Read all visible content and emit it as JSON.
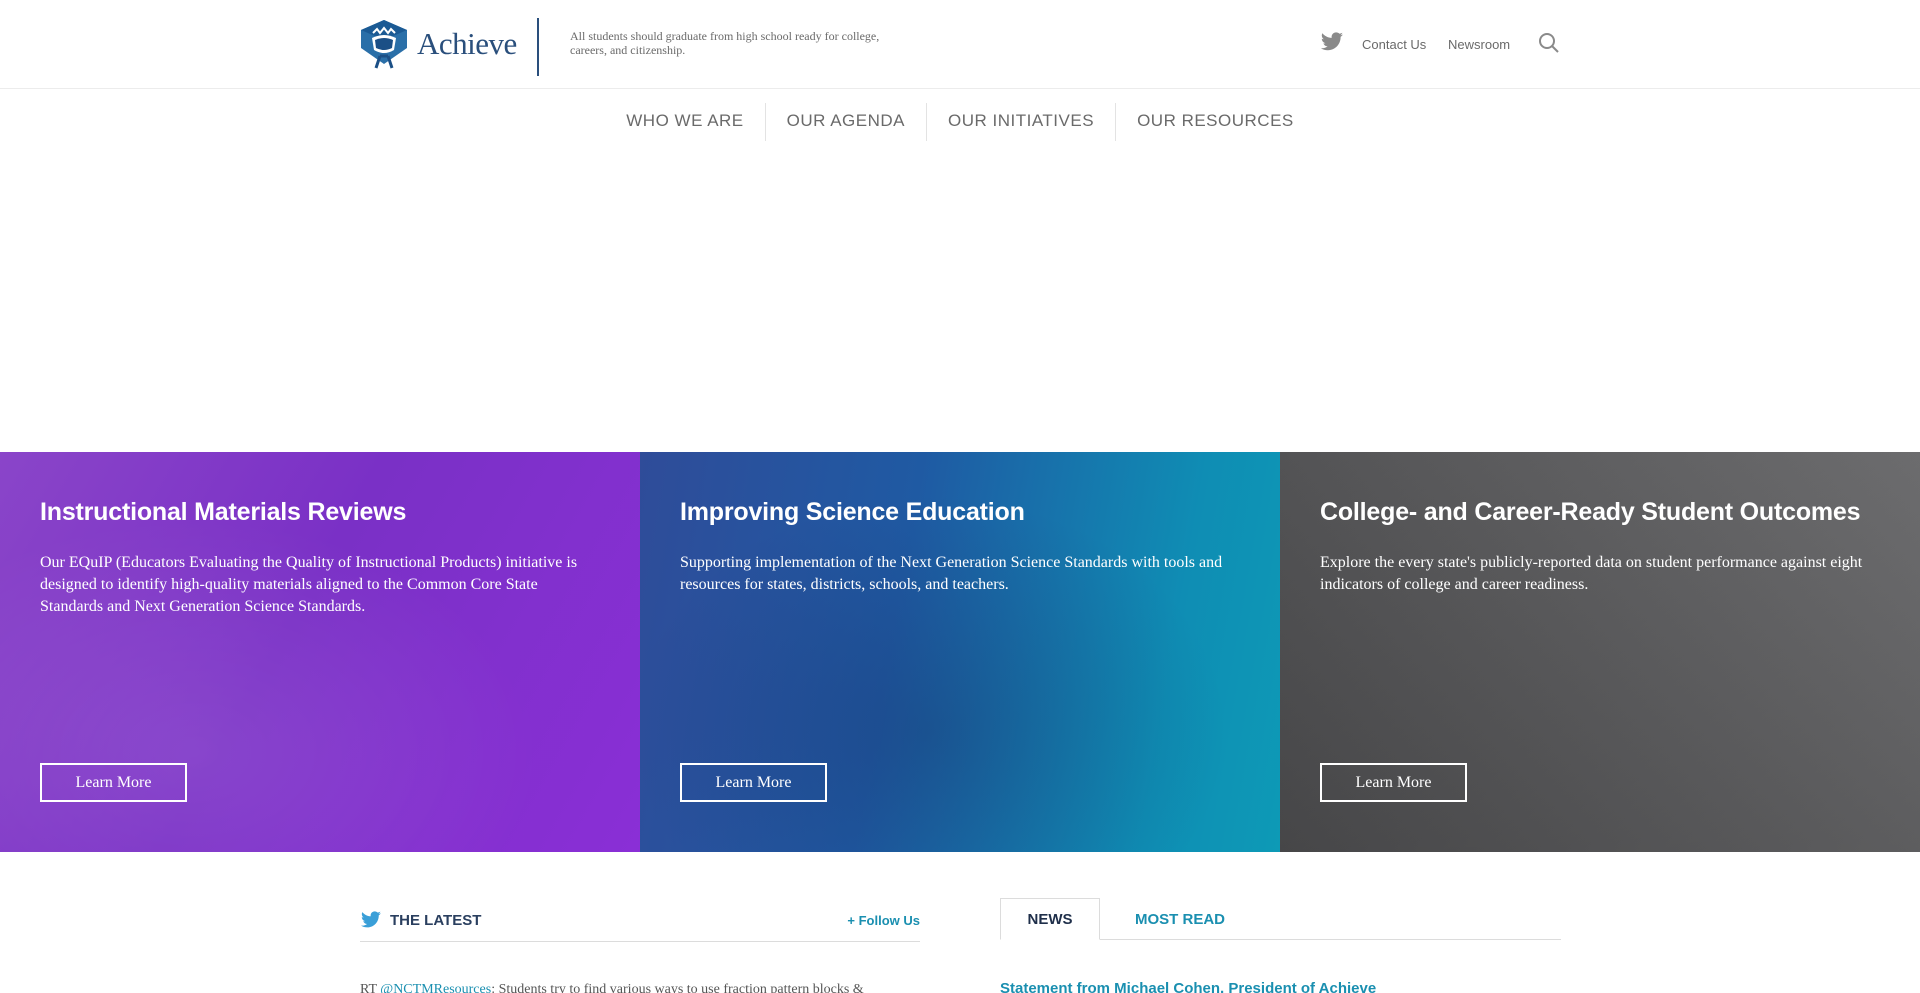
{
  "header": {
    "logo_text": "Achieve",
    "tagline": "All students should graduate from high school ready for college, careers, and citizenship.",
    "utility_links": [
      "Contact Us",
      "Newsroom"
    ]
  },
  "nav": {
    "items": [
      "WHO WE ARE",
      "OUR AGENDA",
      "OUR INITIATIVES",
      "OUR RESOURCES"
    ]
  },
  "features": [
    {
      "title": "Instructional Materials Reviews",
      "description": "Our EQuIP (Educators Evaluating the Quality of Instructional Products) initiative is designed to identify high-quality materials aligned to the Common Core State Standards and Next Generation Science Standards.",
      "button": "Learn More"
    },
    {
      "title": "Improving Science Education",
      "description": "Supporting implementation of the Next Generation Science Standards with tools and resources for states, districts, schools, and teachers.",
      "button": "Learn More"
    },
    {
      "title": "College- and Career-Ready Student Outcomes",
      "description": "Explore the every state's publicly-reported data on student performance against eight indicators of college and career readiness.",
      "button": "Learn More"
    }
  ],
  "latest": {
    "title": "THE LATEST",
    "follow": "+ Follow Us",
    "tweet_prefix": "RT ",
    "tweet_handle": "@NCTMResources",
    "tweet_text": ": Students try to find various ways to use fraction pattern blocks &"
  },
  "news": {
    "tabs": [
      "NEWS",
      "MOST READ"
    ],
    "first_item": "Statement from Michael Cohen, President of Achieve"
  },
  "colors": {
    "brand_navy": "#2a4f7c",
    "link_teal": "#1a8fb0",
    "feature1": "#7a30c6",
    "feature2": "#1f5aa3",
    "feature3": "#5a5a5c"
  }
}
